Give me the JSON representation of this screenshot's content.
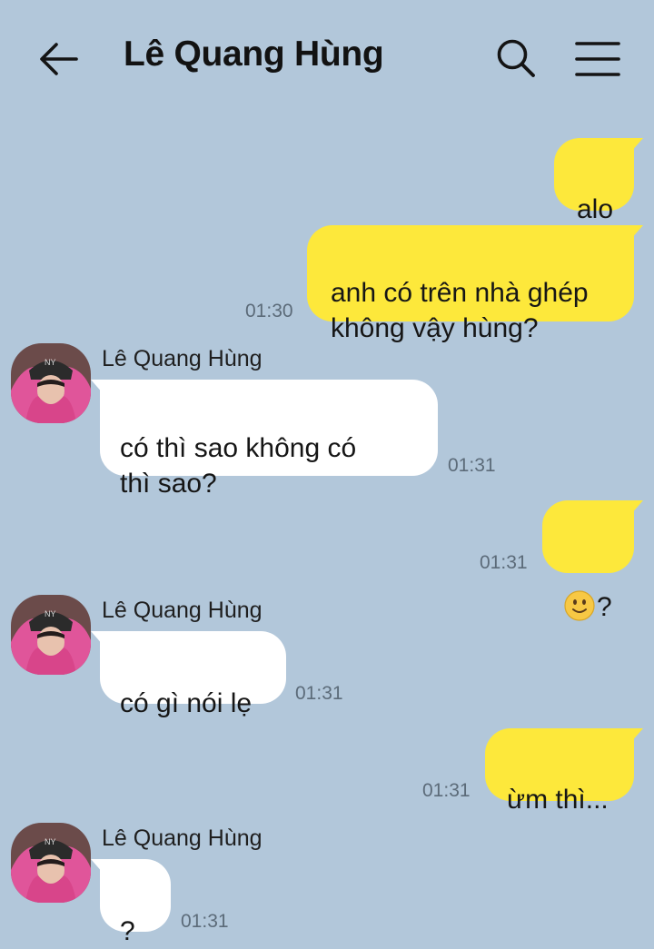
{
  "header": {
    "title": "Lê Quang Hùng",
    "back_icon": "arrow-left-icon",
    "search_icon": "search-icon",
    "menu_icon": "hamburger-menu-icon"
  },
  "contact": {
    "name": "Lê Quang Hùng",
    "avatar": "avatar-pink-hoodie"
  },
  "messages": [
    {
      "from": "me",
      "text": "alo"
    },
    {
      "from": "me",
      "text": "anh có trên nhà ghép\nkhông vậy hùng?",
      "time": "01:30"
    },
    {
      "from": "contact",
      "sender": "Lê Quang Hùng",
      "text": "có thì sao không có\nthì sao?",
      "time": "01:31"
    },
    {
      "from": "me",
      "emoji": "slightly-smiling-face-emoji",
      "text": "?",
      "time": "01:31"
    },
    {
      "from": "contact",
      "sender": "Lê Quang Hùng",
      "text": "có gì nói lẹ",
      "time": "01:31"
    },
    {
      "from": "me",
      "text": "ừm thì...",
      "time": "01:31"
    },
    {
      "from": "contact",
      "sender": "Lê Quang Hùng",
      "text": "?",
      "time": "01:31"
    }
  ],
  "colors": {
    "background": "#b2c7da",
    "outgoing_bubble": "#fde83b",
    "incoming_bubble": "#ffffff",
    "timestamp": "#5c6b79"
  }
}
